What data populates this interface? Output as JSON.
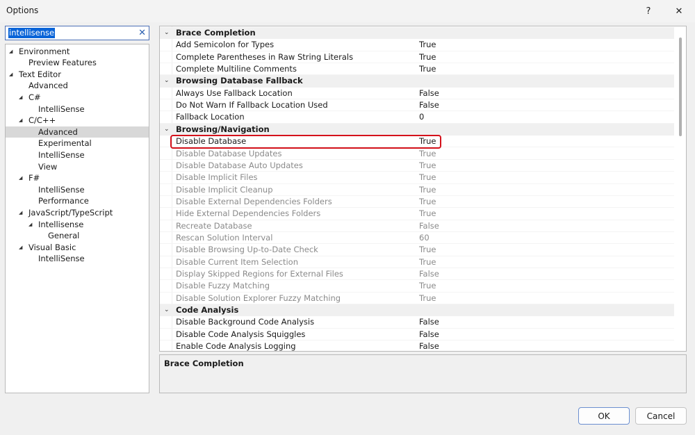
{
  "window": {
    "title": "Options",
    "help_label": "?",
    "close_label": "✕"
  },
  "search": {
    "value": "intellisense",
    "clear_label": "✕"
  },
  "tree": [
    {
      "label": "Environment",
      "level": 0,
      "arrow": true
    },
    {
      "label": "Preview Features",
      "level": 1,
      "arrow": false
    },
    {
      "label": "Text Editor",
      "level": 0,
      "arrow": true
    },
    {
      "label": "Advanced",
      "level": 1,
      "arrow": false
    },
    {
      "label": "C#",
      "level": 1,
      "arrow": true
    },
    {
      "label": "IntelliSense",
      "level": 2,
      "arrow": false
    },
    {
      "label": "C/C++",
      "level": 1,
      "arrow": true
    },
    {
      "label": "Advanced",
      "level": 2,
      "arrow": false,
      "selected": true
    },
    {
      "label": "Experimental",
      "level": 2,
      "arrow": false
    },
    {
      "label": "IntelliSense",
      "level": 2,
      "arrow": false
    },
    {
      "label": "View",
      "level": 2,
      "arrow": false
    },
    {
      "label": "F#",
      "level": 1,
      "arrow": true
    },
    {
      "label": "IntelliSense",
      "level": 2,
      "arrow": false
    },
    {
      "label": "Performance",
      "level": 2,
      "arrow": false
    },
    {
      "label": "JavaScript/TypeScript",
      "level": 1,
      "arrow": true
    },
    {
      "label": "Intellisense",
      "level": 2,
      "arrow": true
    },
    {
      "label": "General",
      "level": 3,
      "arrow": false
    },
    {
      "label": "Visual Basic",
      "level": 1,
      "arrow": true
    },
    {
      "label": "IntelliSense",
      "level": 2,
      "arrow": false
    }
  ],
  "properties": [
    {
      "type": "category",
      "label": "Brace Completion"
    },
    {
      "type": "prop",
      "name": "Add Semicolon for Types",
      "value": "True",
      "disabled": false
    },
    {
      "type": "prop",
      "name": "Complete Parentheses in Raw String Literals",
      "value": "True",
      "disabled": false
    },
    {
      "type": "prop",
      "name": "Complete Multiline Comments",
      "value": "True",
      "disabled": false
    },
    {
      "type": "category",
      "label": "Browsing Database Fallback"
    },
    {
      "type": "prop",
      "name": "Always Use Fallback Location",
      "value": "False",
      "disabled": false
    },
    {
      "type": "prop",
      "name": "Do Not Warn If Fallback Location Used",
      "value": "False",
      "disabled": false
    },
    {
      "type": "prop",
      "name": "Fallback Location",
      "value": "0",
      "disabled": false
    },
    {
      "type": "category",
      "label": "Browsing/Navigation"
    },
    {
      "type": "prop",
      "name": "Disable Database",
      "value": "True",
      "disabled": false,
      "highlighted": true
    },
    {
      "type": "prop",
      "name": "Disable Database Updates",
      "value": "True",
      "disabled": true
    },
    {
      "type": "prop",
      "name": "Disable Database Auto Updates",
      "value": "True",
      "disabled": true
    },
    {
      "type": "prop",
      "name": "Disable Implicit Files",
      "value": "True",
      "disabled": true
    },
    {
      "type": "prop",
      "name": "Disable Implicit Cleanup",
      "value": "True",
      "disabled": true
    },
    {
      "type": "prop",
      "name": "Disable External Dependencies Folders",
      "value": "True",
      "disabled": true
    },
    {
      "type": "prop",
      "name": "Hide External Dependencies Folders",
      "value": "True",
      "disabled": true
    },
    {
      "type": "prop",
      "name": "Recreate Database",
      "value": "False",
      "disabled": true
    },
    {
      "type": "prop",
      "name": "Rescan Solution Interval",
      "value": "60",
      "disabled": true
    },
    {
      "type": "prop",
      "name": "Disable Browsing Up-to-Date Check",
      "value": "True",
      "disabled": true
    },
    {
      "type": "prop",
      "name": "Disable Current Item Selection",
      "value": "True",
      "disabled": true
    },
    {
      "type": "prop",
      "name": "Display Skipped Regions for External Files",
      "value": "False",
      "disabled": true
    },
    {
      "type": "prop",
      "name": "Disable Fuzzy Matching",
      "value": "True",
      "disabled": true
    },
    {
      "type": "prop",
      "name": "Disable Solution Explorer Fuzzy Matching",
      "value": "True",
      "disabled": true
    },
    {
      "type": "category",
      "label": "Code Analysis"
    },
    {
      "type": "prop",
      "name": "Disable Background Code Analysis",
      "value": "False",
      "disabled": false
    },
    {
      "type": "prop",
      "name": "Disable Code Analysis Squiggles",
      "value": "False",
      "disabled": false
    },
    {
      "type": "prop",
      "name": "Enable Code Analysis Logging",
      "value": "False",
      "disabled": false
    }
  ],
  "description": {
    "title": "Brace Completion"
  },
  "buttons": {
    "ok": "OK",
    "cancel": "Cancel"
  },
  "colors": {
    "highlight_border": "#d4111b",
    "search_selection": "#0a64d8",
    "tree_selected": "#d8d8d8"
  }
}
